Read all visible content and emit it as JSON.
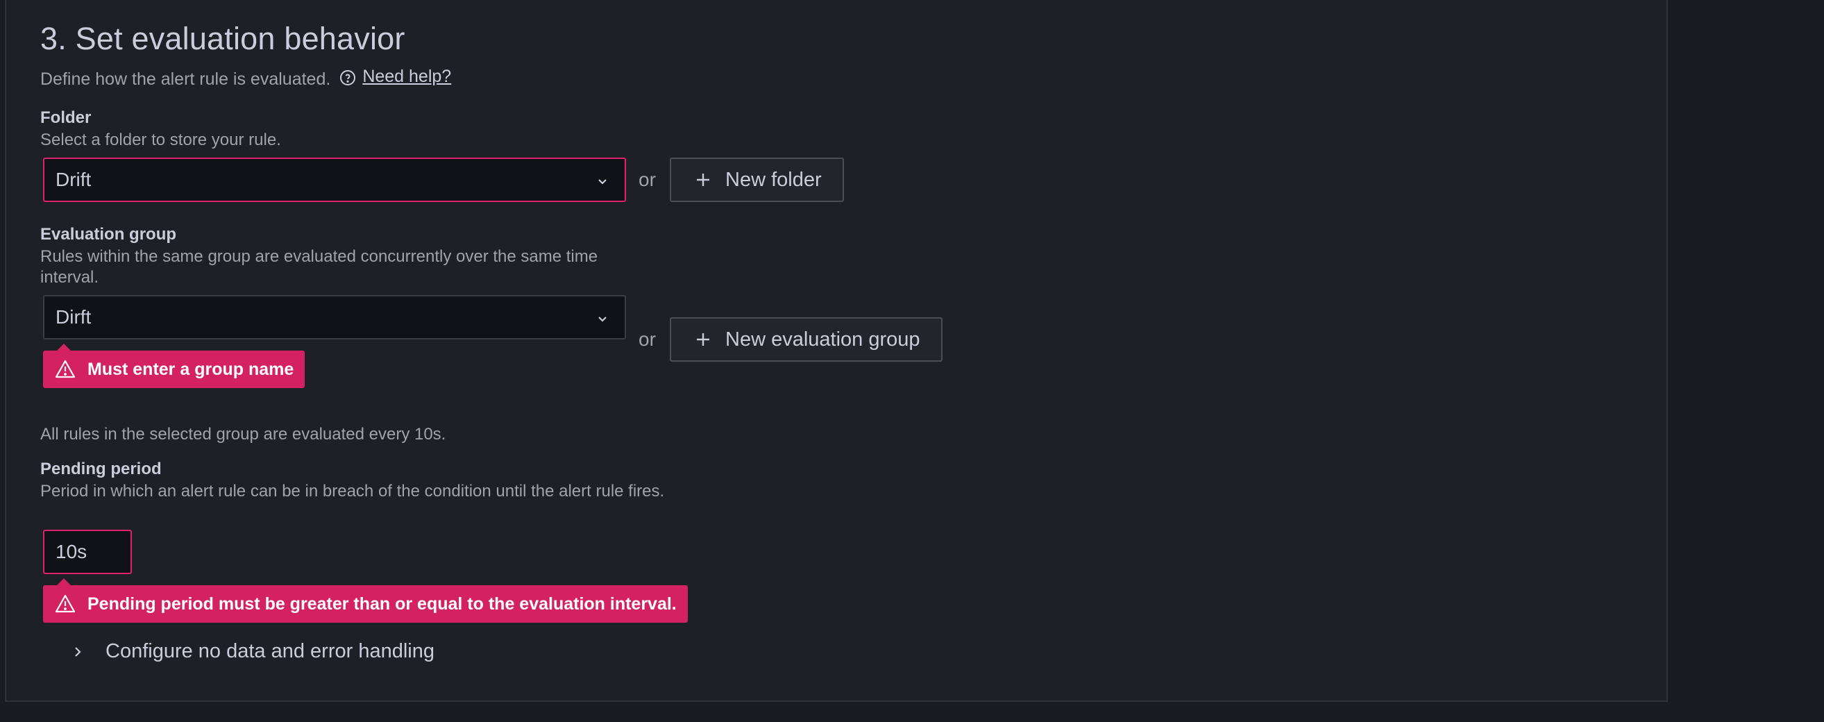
{
  "section": {
    "title": "3. Set evaluation behavior",
    "subtitle": "Define how the alert rule is evaluated.",
    "help_link": "Need help?",
    "help_icon": "question-circle-icon"
  },
  "folder": {
    "label": "Folder",
    "description": "Select a folder to store your rule.",
    "selected": "Drift",
    "or_text": "or",
    "new_button": "New folder"
  },
  "evaluation_group": {
    "label": "Evaluation group",
    "description": "Rules within the same group are evaluated concurrently over the same time interval.",
    "selected": "Dirft",
    "error": "Must enter a group name",
    "or_text": "or",
    "new_button": "New evaluation group",
    "note": "All rules in the selected group are evaluated every 10s."
  },
  "pending_period": {
    "label": "Pending period",
    "description": "Period in which an alert rule can be in breach of the condition until the alert rule fires.",
    "value": "10s",
    "error": "Pending period must be greater than or equal to the evaluation interval."
  },
  "no_data_section": {
    "label": "Configure no data and error handling",
    "expanded": false
  },
  "colors": {
    "background": "#181b1f",
    "panel": "#1d2026",
    "error": "#d4215f",
    "invalid_border": "#e0226e",
    "text_primary": "#ccccdc",
    "text_secondary": "#a0a3ab"
  }
}
